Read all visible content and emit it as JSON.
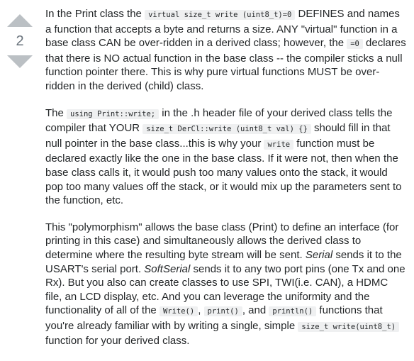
{
  "vote": {
    "count": "2"
  },
  "p1": {
    "t1": "In the Print class the ",
    "c1": "virtual size_t write (uint8_t)=0",
    "t2": " DEFINES and names a function that accepts a byte and returns a size. ANY \"virtual\" function in a base class CAN be over-ridden in a derived class; however, the ",
    "c2": "=0",
    "t3": " declares that there is NO actual function in the base class -- the compiler sticks a null function pointer there. This is why pure virtual functions MUST be over-ridden in the derived (child) class."
  },
  "p2": {
    "t1": "The ",
    "c1": "using Print::write;",
    "t2": " in the .h header file of your derived class tells the compiler that YOUR ",
    "c2": "size_t DerCl::write (uint8_t val) {}",
    "t3": " should fill in that null pointer in the base class...this is why your ",
    "c3": "write",
    "t4": " function must be declared exactly like the one in the base class. If it were not, then when the base class calls it, it would push too many values onto the stack, it would pop too many values off the stack, or it would mix up the parameters sent to the function, etc."
  },
  "p3": {
    "t1": "This \"polymorphism\" allows the base class (Print) to define an interface (for printing in this case) and simultaneously allows the derived class to determine where the resulting byte stream will be sent. ",
    "e1": "Serial",
    "t2": " sends it to the USART's serial port. ",
    "e2": "SoftSerial",
    "t3": " sends it to any two port pins (one Tx and one Rx). But you also can create classes to use SPI, TWI(i.e. CAN), a HDMC file, an LCD display, etc. And you can leverage the uniformity and the functionality of all of the ",
    "c1": "Write()",
    "t4": ", ",
    "c2": "print()",
    "t5": ", and ",
    "c3": "println()",
    "t6": " functions that you're already familiar with by writing a single, simple ",
    "c4": "size_t write(uint8_t)",
    "t7": " function for your derived class."
  }
}
